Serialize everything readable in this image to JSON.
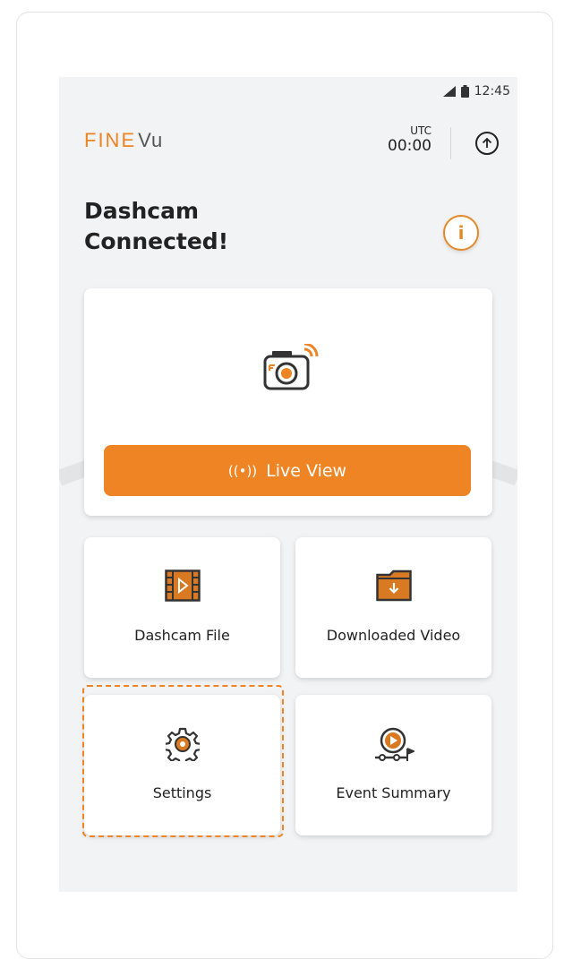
{
  "status_bar": {
    "time": "12:45",
    "signal_icon": "signal-icon",
    "battery_icon": "battery-icon"
  },
  "header": {
    "logo_text_bold": "FINE",
    "logo_text_light": "Vu",
    "utc_label": "UTC",
    "utc_time": "00:00",
    "upload_icon": "upload-icon"
  },
  "title": {
    "line1": "Dashcam",
    "line2": "Connected!"
  },
  "info_button": {
    "icon": "info-icon",
    "label": "i"
  },
  "live_view": {
    "icon": "dashcam-wireless-icon",
    "button_icon": "broadcast-icon",
    "button_label": "Live View"
  },
  "menu": [
    {
      "label": "Dashcam File",
      "icon": "film-icon"
    },
    {
      "label": "Downloaded Video",
      "icon": "download-folder-icon"
    },
    {
      "label": "Settings",
      "icon": "gear-icon"
    },
    {
      "label": "Event Summary",
      "icon": "event-video-icon"
    }
  ],
  "colors": {
    "accent": "#ee8424",
    "icon_fill": "#d97a23",
    "background": "#f2f3f5"
  }
}
